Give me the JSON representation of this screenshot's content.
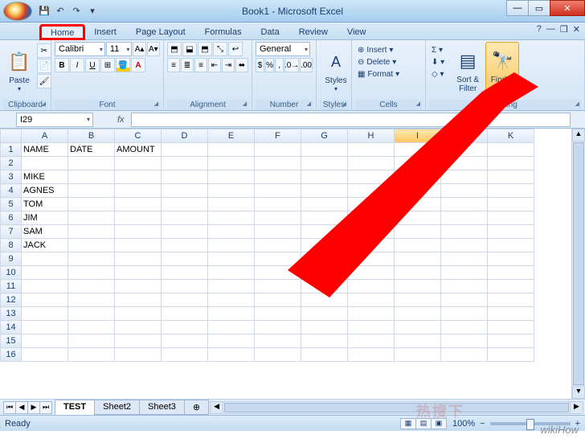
{
  "app": {
    "title": "Book1 - Microsoft Excel"
  },
  "qat": {
    "save": "💾",
    "undo": "↶",
    "redo": "↷"
  },
  "tabs": [
    "Home",
    "Insert",
    "Page Layout",
    "Formulas",
    "Data",
    "Review",
    "View"
  ],
  "active_tab": "Home",
  "ribbon": {
    "clipboard": {
      "label": "Clipboard",
      "paste": "Paste"
    },
    "font": {
      "label": "Font",
      "name": "Calibri",
      "size": "11"
    },
    "alignment": {
      "label": "Alignment"
    },
    "number": {
      "label": "Number",
      "format": "General"
    },
    "styles": {
      "label": "Styles",
      "btn": "Styles"
    },
    "cells": {
      "label": "Cells",
      "insert": "Insert",
      "delete": "Delete",
      "format": "Format"
    },
    "editing": {
      "label": "Editing",
      "sort": "Sort &\nFilter",
      "find": "Find &\nSelect"
    }
  },
  "namebox": "I29",
  "fx": "fx",
  "columns": [
    "A",
    "B",
    "C",
    "D",
    "E",
    "F",
    "G",
    "H",
    "I",
    "J",
    "K"
  ],
  "active_col": "I",
  "rows": 16,
  "cells": {
    "A1": "NAME",
    "B1": "DATE",
    "C1": "AMOUNT",
    "A3": "MIKE",
    "A4": "AGNES",
    "A5": "TOM",
    "A6": "JIM",
    "A7": "SAM",
    "A8": "JACK"
  },
  "sheets": [
    "TEST",
    "Sheet2",
    "Sheet3"
  ],
  "active_sheet": "TEST",
  "status": {
    "mode": "Ready",
    "zoom": "100%"
  },
  "watermark": "wikiHow",
  "cn_watermark": "热搜下"
}
